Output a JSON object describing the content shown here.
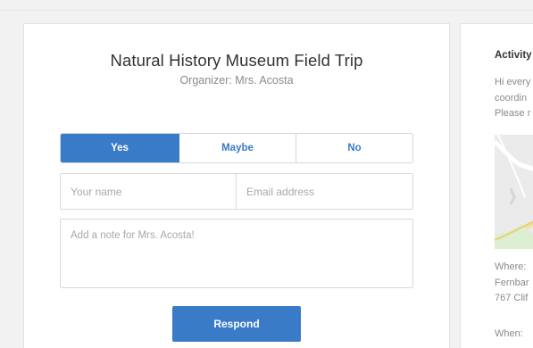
{
  "event": {
    "title": "Natural History Museum Field Trip",
    "organizer": "Organizer: Mrs. Acosta"
  },
  "rsvp": {
    "options": [
      "Yes",
      "Maybe",
      "No"
    ],
    "selected": "Yes"
  },
  "form": {
    "name_placeholder": "Your name",
    "email_placeholder": "Email address",
    "note_placeholder": "Add a note for Mrs. Acosta!",
    "submit_label": "Respond"
  },
  "activity": {
    "title": "Activity",
    "lines": [
      "Hi every",
      "coordin",
      "Please r"
    ],
    "where_label": "Where:",
    "where_lines": [
      "Fernbar",
      "767 Clif"
    ],
    "when_label": "When:"
  },
  "colors": {
    "accent": "#3a7bc8",
    "background": "#f2f2f2"
  }
}
